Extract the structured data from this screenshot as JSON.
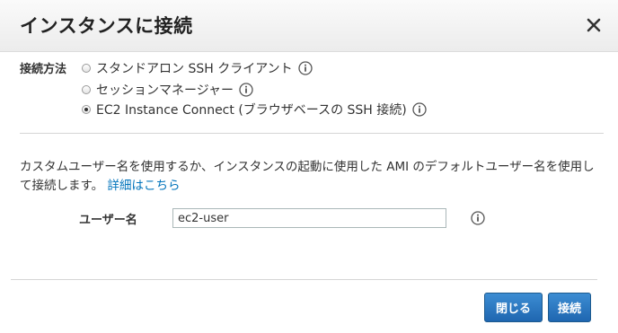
{
  "dialog": {
    "title": "インスタンスに接続",
    "close_icon": "close-icon"
  },
  "connection_method": {
    "label": "接続方法",
    "options": [
      {
        "label": "スタンドアロン SSH クライアント",
        "selected": false
      },
      {
        "label": "セッションマネージャー",
        "selected": false
      },
      {
        "label": "EC2 Instance Connect (ブラウザベースの SSH 接続)",
        "selected": true
      }
    ],
    "info_icon": "info-icon"
  },
  "description": {
    "text": "カスタムユーザー名を使用するか、インスタンスの起動に使用した AMI のデフォルトユーザー名を使用して接続します。",
    "link": "詳細はこちら"
  },
  "username": {
    "label": "ユーザー名",
    "value": "ec2-user"
  },
  "footer": {
    "close_label": "閉じる",
    "connect_label": "接続"
  },
  "colors": {
    "accent": "#1f66b0",
    "link": "#0073bb",
    "header_bg": "#f2f2f2"
  }
}
